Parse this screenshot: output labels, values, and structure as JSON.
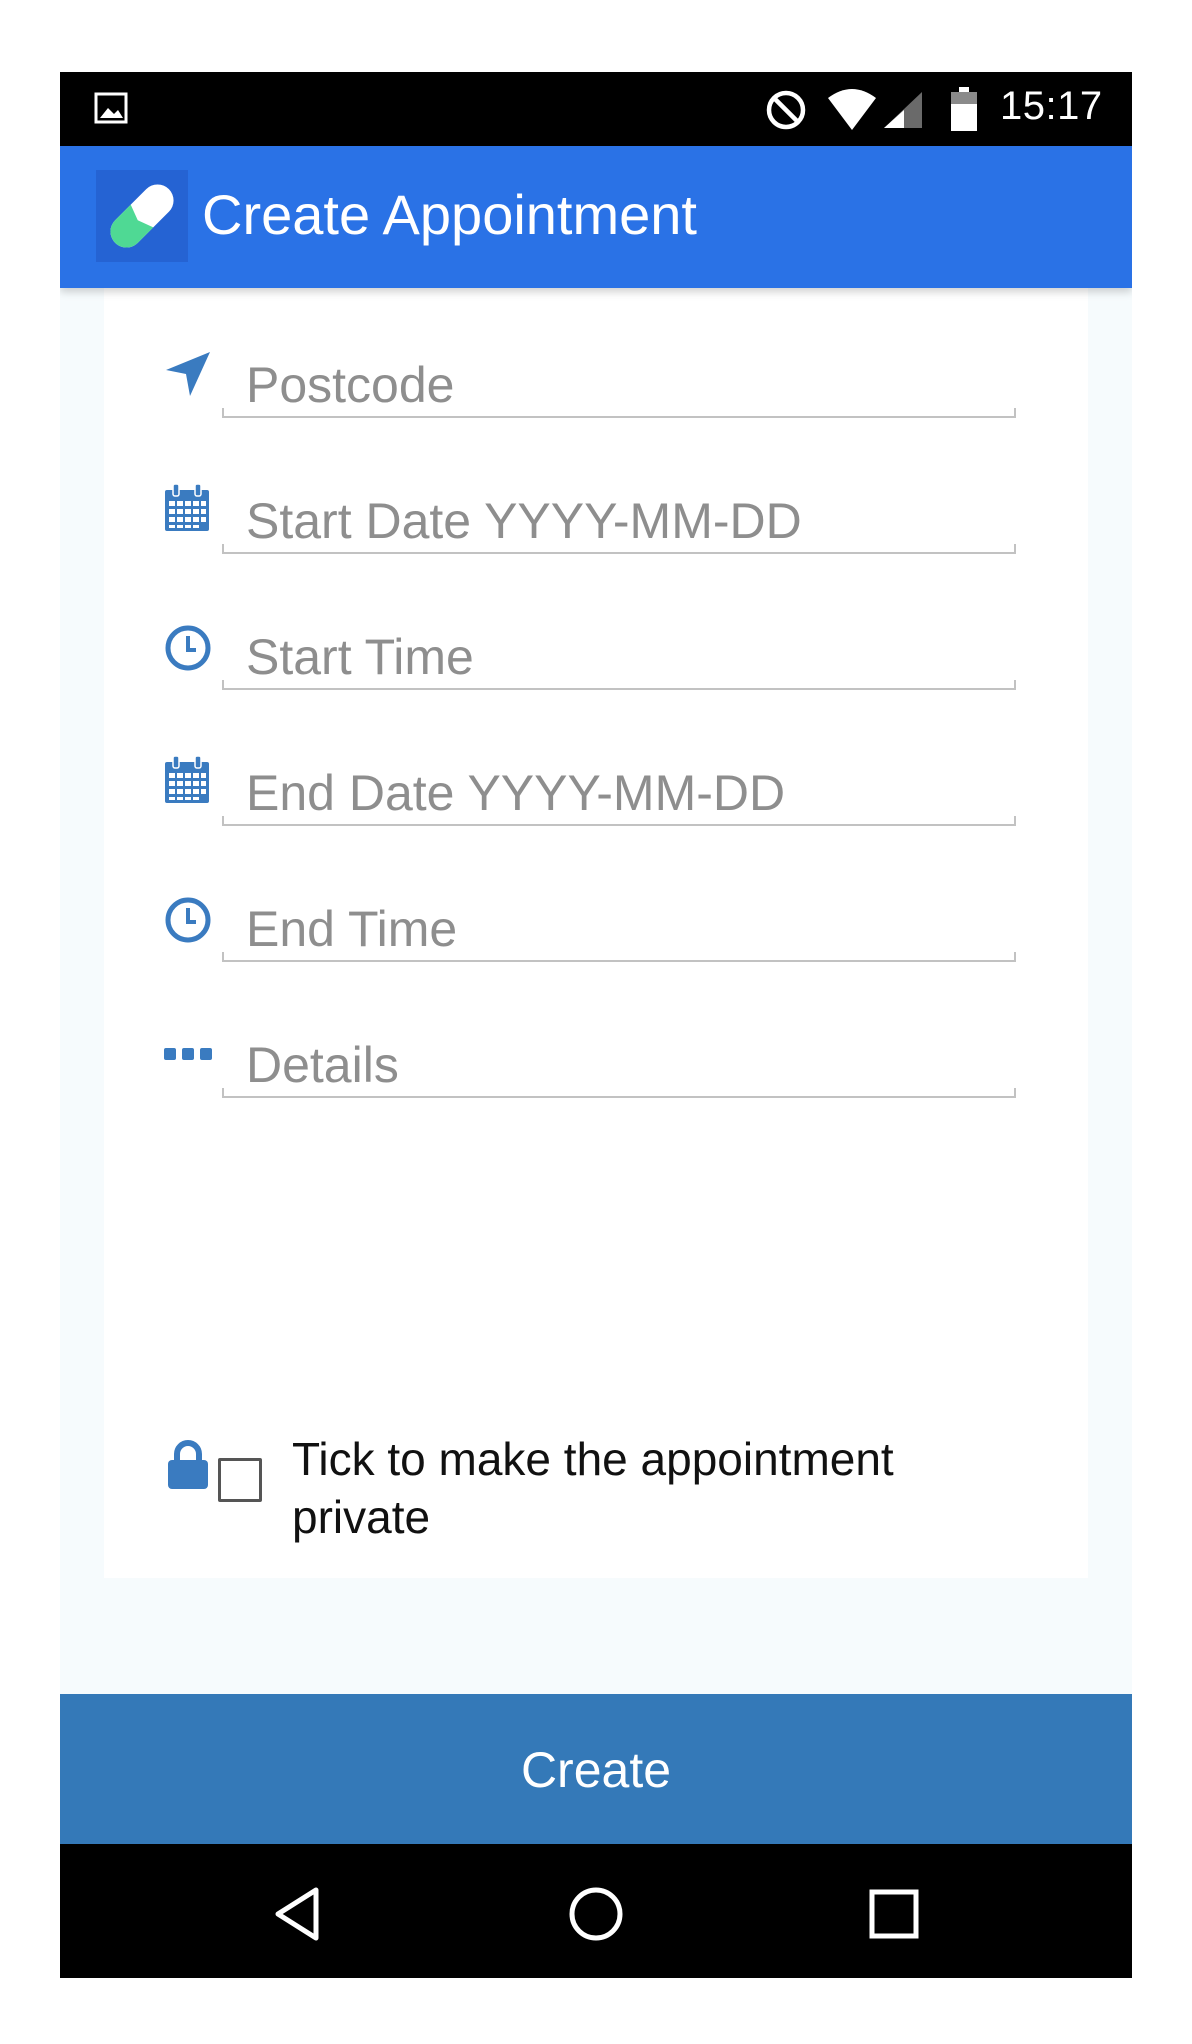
{
  "status_bar": {
    "time": "15:17",
    "icons": [
      "image-notification-icon",
      "do-not-disturb-icon",
      "wifi-icon",
      "cell-signal-icon",
      "battery-icon"
    ]
  },
  "app_bar": {
    "title": "Create Appointment",
    "logo": "pill-logo-icon",
    "color": "#2a72e6"
  },
  "form": {
    "fields": [
      {
        "id": "postcode",
        "icon": "location-arrow-icon",
        "placeholder": "Postcode",
        "value": ""
      },
      {
        "id": "start_date",
        "icon": "calendar-icon",
        "placeholder": "Start Date YYYY-MM-DD",
        "value": ""
      },
      {
        "id": "start_time",
        "icon": "clock-icon",
        "placeholder": "Start Time",
        "value": ""
      },
      {
        "id": "end_date",
        "icon": "calendar-icon",
        "placeholder": "End Date YYYY-MM-DD",
        "value": ""
      },
      {
        "id": "end_time",
        "icon": "clock-icon",
        "placeholder": "End Time",
        "value": ""
      },
      {
        "id": "details",
        "icon": "ellipsis-icon",
        "placeholder": "Details",
        "value": ""
      }
    ],
    "private_checkbox": {
      "icon": "lock-icon",
      "label": "Tick to make the appointment private",
      "checked": false
    },
    "icon_color": "#3a7bc0"
  },
  "actions": {
    "create_label": "Create",
    "button_color": "#3479b8"
  },
  "nav_bar": {
    "buttons": [
      "back-icon",
      "home-icon",
      "recents-icon"
    ]
  }
}
